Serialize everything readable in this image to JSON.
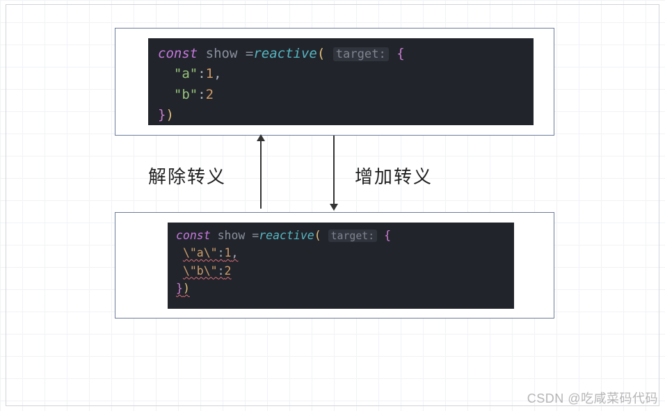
{
  "labels": {
    "unescape": "解除转义",
    "escape": "增加转义"
  },
  "code_top": {
    "keyword": "const",
    "variable": "show",
    "op_eq": " =",
    "fn": "reactive",
    "hint": "target:",
    "brace_open": "{",
    "entries": [
      {
        "key": "\"a\"",
        "colon": ":",
        "value": "1",
        "comma": ","
      },
      {
        "key": "\"b\"",
        "colon": ":",
        "value": "2",
        "comma": ""
      }
    ],
    "close": "})"
  },
  "code_bot": {
    "keyword": "const",
    "variable": "show",
    "op_eq": " =",
    "fn": "reactive",
    "hint": "target:",
    "brace_open": "{",
    "entries": [
      {
        "key": "\\\"a\\\"",
        "colon": ":",
        "value": "1",
        "comma": ","
      },
      {
        "key": "\\\"b\\\"",
        "colon": ":",
        "value": "2",
        "comma": ""
      }
    ],
    "close": "})"
  },
  "watermark": "CSDN @吃咸菜码代码"
}
